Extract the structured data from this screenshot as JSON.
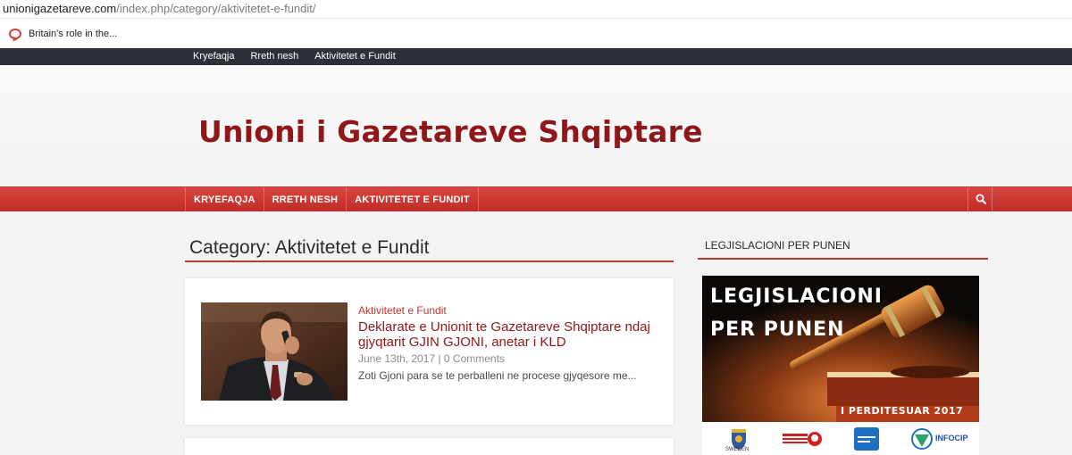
{
  "browser": {
    "url_domain": "unionigazetareve.com",
    "url_path": "/index.php/category/aktivitetet-e-fundit/",
    "bookmark_label": "Britain's role in the..."
  },
  "topbar": {
    "links": [
      "Kryefaqja",
      "Rreth nesh",
      "Aktivitetet e Fundit"
    ]
  },
  "header": {
    "site_title": "Unioni i Gazetareve Shqiptare"
  },
  "mainnav": {
    "items": [
      "KRYEFAQJA",
      "RRETH NESH",
      "AKTIVITETET E FUNDIT"
    ]
  },
  "main": {
    "category_title": "Category: Aktivitetet e Fundit",
    "posts": [
      {
        "category": "Aktivitetet e Fundit",
        "title": "Deklarate e Unionit te Gazetareve Shqiptare ndaj gjyqtarit GJIN GJONI, anetar i KLD",
        "date": "June 13th, 2017",
        "separator": "|",
        "comments": "0 Comments",
        "excerpt": "Zoti Gjoni para se te perballeni ne procese gjyqesore me..."
      }
    ]
  },
  "sidebar": {
    "widget_title": "LEGJISLACIONI PER PUNEN",
    "banner": {
      "line1": "LEGJISLACIONI",
      "line2": "PER PUNEN",
      "line3": "I PERDITESUAR 2017",
      "logo_sweden": "SWEDEN",
      "logo_infocip": "INFOCIP"
    }
  },
  "colors": {
    "brand_red": "#c0352f",
    "title_red": "#8f1719",
    "topbar_dark": "#2b3137"
  }
}
